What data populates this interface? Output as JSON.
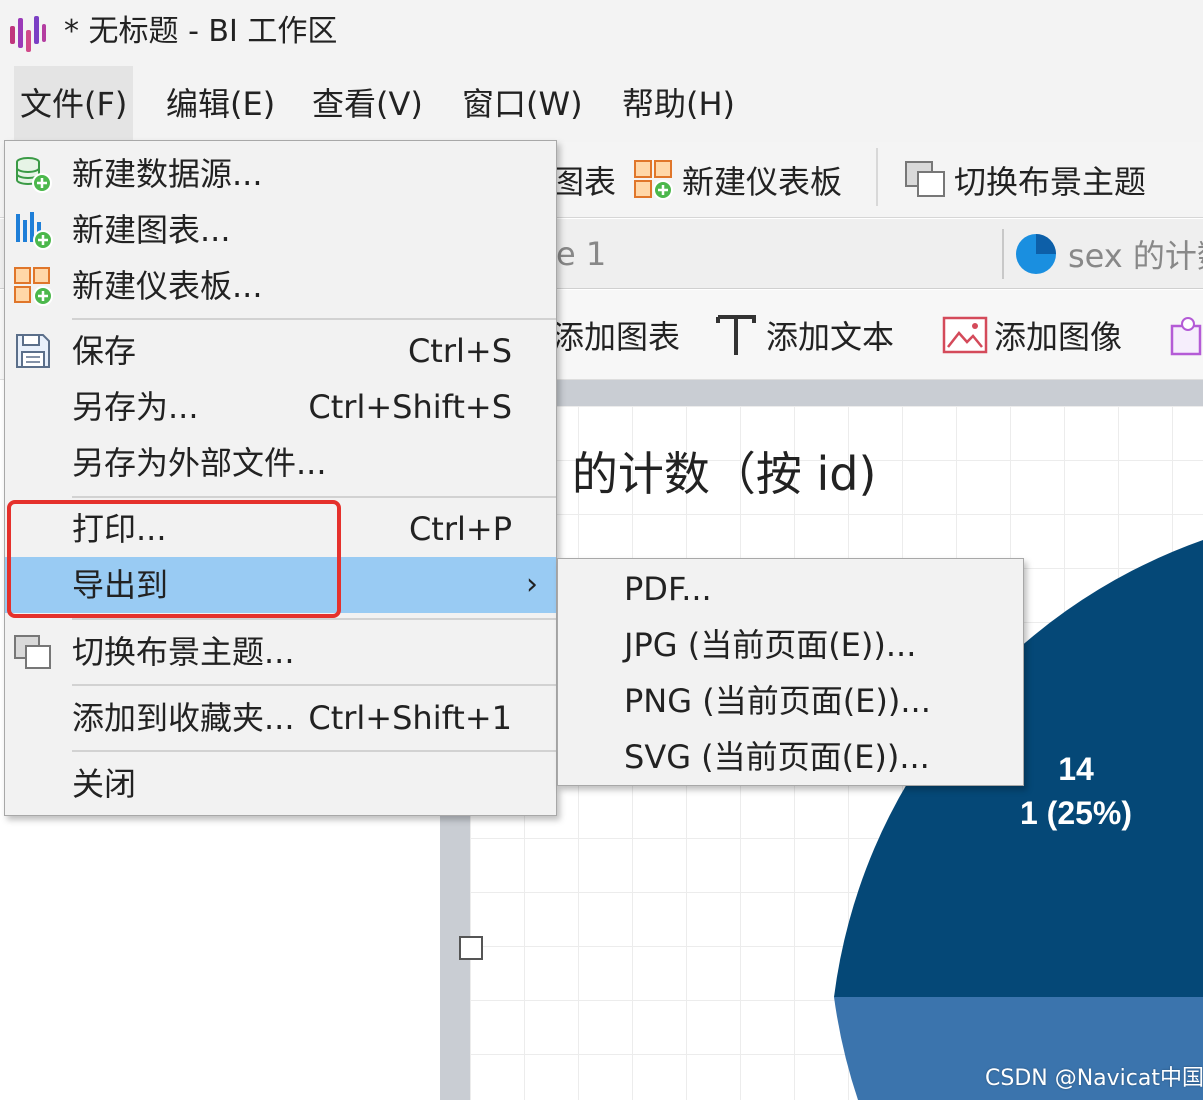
{
  "window": {
    "title": "* 无标题 - BI 工作区"
  },
  "menubar": {
    "items": [
      {
        "label": "文件(F)"
      },
      {
        "label": "编辑(E)"
      },
      {
        "label": "查看(V)"
      },
      {
        "label": "窗口(W)"
      },
      {
        "label": "帮助(H)"
      }
    ]
  },
  "toolbar": {
    "new_chart_partial": "图表",
    "new_dashboard": "新建仪表板",
    "switch_theme": "切换布景主题"
  },
  "tabs": {
    "left_partial": "e 1",
    "right_partial": "sex 的计数"
  },
  "toolbar2": {
    "add_chart_partial": "添加图表",
    "add_text": "添加文本",
    "add_image": "添加图像"
  },
  "chart": {
    "title_partial": "x 的计数（按 id)"
  },
  "chart_data": {
    "type": "pie",
    "title": "sex 的计数（按 id)",
    "slices": [
      {
        "name": "14",
        "value_label": "1 (25%)",
        "value": 1,
        "percent": 25,
        "color": "#054877"
      }
    ],
    "other_slice_color": "#3b74ad"
  },
  "file_menu": {
    "items": [
      {
        "label": "新建数据源...",
        "shortcut": "",
        "icon": "new-datasource-icon"
      },
      {
        "label": "新建图表...",
        "shortcut": "",
        "icon": "new-chart-icon"
      },
      {
        "label": "新建仪表板...",
        "shortcut": "",
        "icon": "new-dashboard-icon"
      },
      {
        "label": "保存",
        "shortcut": "Ctrl+S",
        "icon": "save-icon"
      },
      {
        "label": "另存为...",
        "shortcut": "Ctrl+Shift+S",
        "icon": ""
      },
      {
        "label": "另存为外部文件...",
        "shortcut": "",
        "icon": ""
      },
      {
        "label": "打印...",
        "shortcut": "Ctrl+P",
        "icon": ""
      },
      {
        "label": "导出到",
        "shortcut": "",
        "icon": "",
        "submenu": true,
        "arrow": "›"
      },
      {
        "label": "切换布景主题...",
        "shortcut": "",
        "icon": "switch-theme-icon"
      },
      {
        "label": "添加到收藏夹...",
        "shortcut": "Ctrl+Shift+1",
        "icon": ""
      },
      {
        "label": "关闭",
        "shortcut": "",
        "icon": ""
      }
    ]
  },
  "export_menu": {
    "items": [
      {
        "label": "PDF..."
      },
      {
        "label": "JPG (当前页面(E))..."
      },
      {
        "label": "PNG (当前页面(E))..."
      },
      {
        "label": "SVG (当前页面(E))..."
      }
    ]
  },
  "watermark": "CSDN @Navicat中国",
  "colors": {
    "menu_bg": "#f2f2f2",
    "highlight": "#99cbf3",
    "annotation_red": "#e5312c",
    "pie_dark": "#054877",
    "pie_mid": "#3b74ad"
  }
}
